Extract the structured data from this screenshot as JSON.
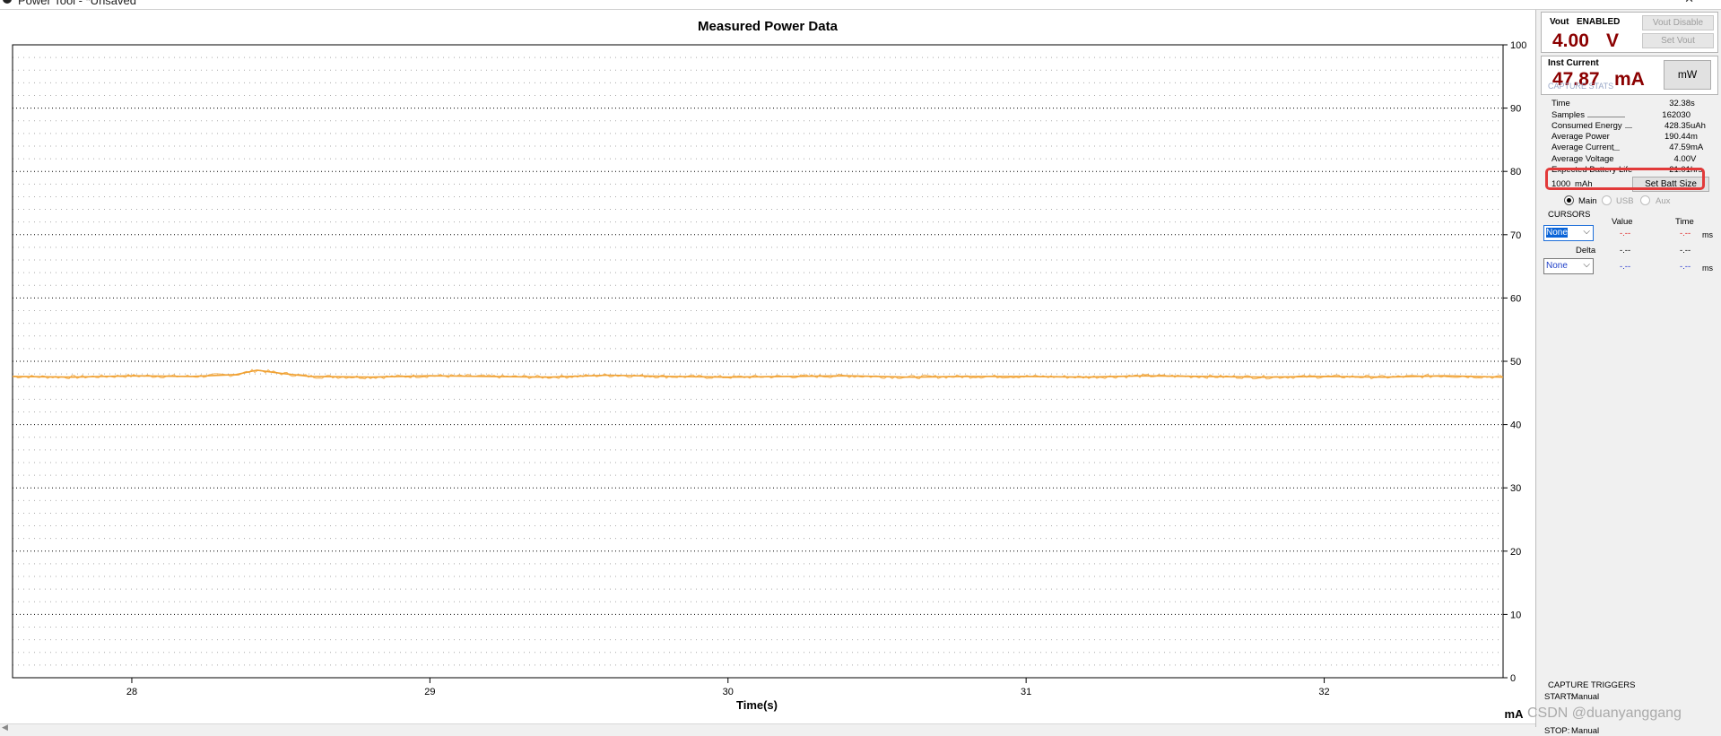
{
  "window": {
    "title": "Power Tool - *Unsaved"
  },
  "chart_data": {
    "type": "line",
    "title": "Measured Power Data",
    "xlabel": "Time(s)",
    "ylabel": "mA",
    "xlim": [
      27.6,
      32.6
    ],
    "ylim": [
      0,
      100
    ],
    "x_ticks": [
      "28",
      "29",
      "30",
      "31",
      "32"
    ],
    "y_ticks": [
      "0",
      "10",
      "20",
      "30",
      "40",
      "50",
      "60",
      "70",
      "80",
      "90",
      "100"
    ],
    "y_axis_position": "right",
    "grid": true,
    "series": [
      {
        "color": "#f0a030",
        "x": [
          27.6,
          27.8,
          28.0,
          28.2,
          28.35,
          28.42,
          28.5,
          28.6,
          28.8,
          29.0,
          29.2,
          29.4,
          29.6,
          29.8,
          30.0,
          30.2,
          30.4,
          30.6,
          30.8,
          31.0,
          31.2,
          31.4,
          31.6,
          31.8,
          32.0,
          32.2,
          32.4,
          32.6
        ],
        "y": [
          47.6,
          47.5,
          47.7,
          47.6,
          47.9,
          48.6,
          48.1,
          47.6,
          47.5,
          47.7,
          47.6,
          47.5,
          47.8,
          47.6,
          47.5,
          47.6,
          47.7,
          47.5,
          47.6,
          47.6,
          47.5,
          47.7,
          47.6,
          47.5,
          47.6,
          47.5,
          47.7,
          47.5
        ]
      }
    ]
  },
  "vout": {
    "label": "Vout",
    "status": "ENABLED",
    "value": "4.00",
    "unit": "V",
    "disable_btn": "Vout Disable",
    "set_btn": "Set Vout"
  },
  "current": {
    "label": "Inst Current",
    "value": "47.87",
    "unit": "mA",
    "mode_btn": "mW"
  },
  "capture_stats": {
    "title": "CAPTURE STATS",
    "rows": [
      {
        "label": "Time",
        "value": "32.38",
        "unit": "s"
      },
      {
        "label": "Samples",
        "value": "162030",
        "unit": ""
      },
      {
        "label": "Consumed Energy",
        "value": "428.35",
        "unit": "uAh"
      },
      {
        "label": "Average Power",
        "value": "190.44",
        "unit": "m"
      },
      {
        "label": "Average Current",
        "value": "47.59",
        "unit": "mA"
      },
      {
        "label": "Average Voltage",
        "value": "4.00",
        "unit": "V"
      },
      {
        "label": "Expected Battery Life",
        "value": "21.01",
        "unit": "hrs"
      }
    ],
    "battery_size": "1000",
    "battery_unit": "mAh",
    "set_batt_btn": "Set Batt Size",
    "channels": [
      "Main",
      "USB",
      "Aux"
    ]
  },
  "cursors": {
    "title": "CURSORS",
    "col_value": "Value",
    "col_time": "Time",
    "cursor1": {
      "select": "None",
      "value": "-.--",
      "time": "-.--",
      "unit": "ms"
    },
    "delta": {
      "label": "Delta",
      "value": "-.--",
      "time": "-.--"
    },
    "cursor2": {
      "select": "None",
      "value": "-.--",
      "time": "-.--",
      "unit": "ms"
    }
  },
  "triggers": {
    "title": "CAPTURE TRIGGERS",
    "start_label": "START:",
    "start_value": "Manual",
    "stop_label": "STOP:",
    "stop_value": "Manual"
  },
  "watermark": "CSDN @duanyanggang",
  "colors": {
    "value_red": "#8b0000",
    "trace": "#f0a030",
    "highlight": "#e23a3a"
  }
}
